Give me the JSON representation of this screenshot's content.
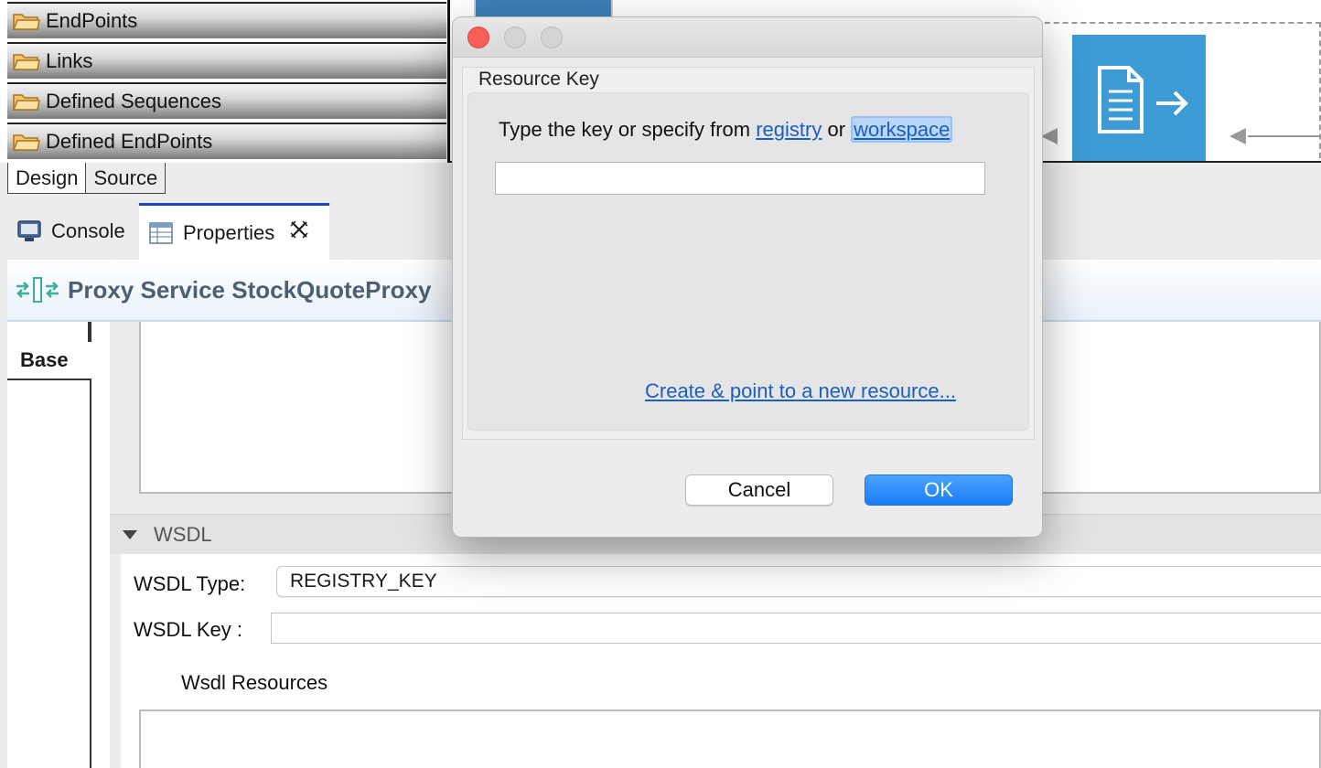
{
  "palette": {
    "items": [
      {
        "label": "EndPoints",
        "icon": "folder-icon"
      },
      {
        "label": "Links",
        "icon": "folder-icon"
      },
      {
        "label": "Defined Sequences",
        "icon": "folder-icon"
      },
      {
        "label": "Defined EndPoints",
        "icon": "folder-icon"
      }
    ],
    "tabs": [
      "Design",
      "Source"
    ]
  },
  "views": {
    "console_label": "Console",
    "properties_label": "Properties"
  },
  "properties": {
    "header_title": "Proxy Service StockQuoteProxy",
    "side_tab": "Base",
    "wsdl_section": "WSDL",
    "wsdl_type_label": "WSDL Type:",
    "wsdl_type_value": "REGISTRY_KEY",
    "wsdl_key_label": "WSDL Key :",
    "wsdl_key_value": "",
    "wsdl_resources_label": "Wsdl Resources"
  },
  "dialog": {
    "group_label": "Resource Key",
    "prompt_prefix": "Type the key or specify from ",
    "registry_link": "registry",
    "or_text": " or ",
    "workspace_link": "workspace",
    "key_value": "",
    "create_link": "Create & point to a new resource...",
    "cancel_label": "Cancel",
    "ok_label": "OK"
  },
  "colors": {
    "accent_blue": "#1b7cf5",
    "link_blue": "#1a5fc1",
    "mediator_blue": "#3d9bd6",
    "close_red": "#fc5f57"
  }
}
